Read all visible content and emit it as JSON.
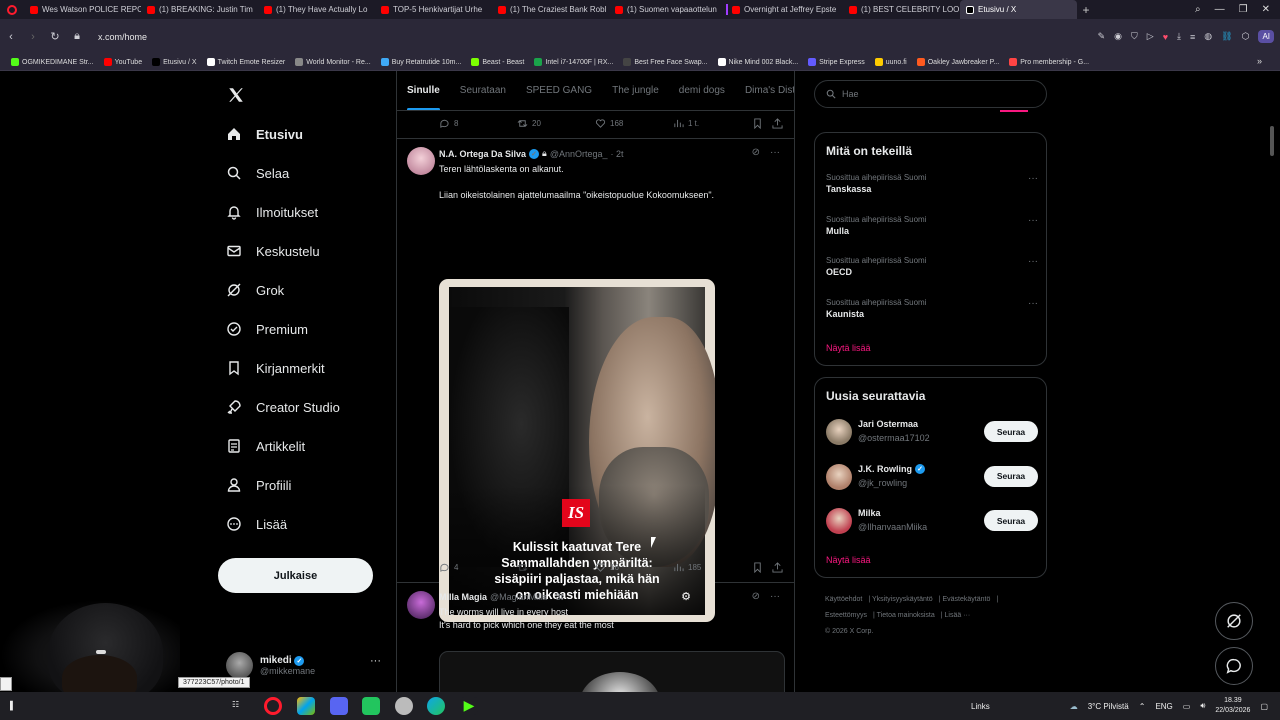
{
  "browser": {
    "tabs": [
      {
        "label": "Wes Watson POLICE REPO",
        "color": "#ff0000",
        "active": false
      },
      {
        "label": "(1) BREAKING: Justin Tim",
        "color": "#ff0000",
        "active": false
      },
      {
        "label": "(1) They Have Actually Lo",
        "color": "#ff0000",
        "active": false
      },
      {
        "label": "TOP-5 Henkivartijat Urhe",
        "color": "#ff0000",
        "active": false
      },
      {
        "label": "(1) The Craziest Bank Robl",
        "color": "#ff0000",
        "active": false
      },
      {
        "label": "(1) Suomen vapaaottelun",
        "color": "#ff0000",
        "active": false
      },
      {
        "label": "Overnight at Jeffrey Epste",
        "color": "#ff0000",
        "active": false
      },
      {
        "label": "(1) BEST CELEBRITY LOOK",
        "color": "#ff0000",
        "active": false
      },
      {
        "label": "Etusivu / X",
        "color": "#000000",
        "active": true
      }
    ],
    "url": "x.com/home",
    "ai_label": "AI",
    "bookmarks": [
      {
        "label": "OGMIKEDIMANE Str...",
        "color": "#53fc18"
      },
      {
        "label": "YouTube",
        "color": "#ff0000"
      },
      {
        "label": "Etusivu / X",
        "color": "#000000"
      },
      {
        "label": "Twitch Emote Resizer",
        "color": "#ffffff"
      },
      {
        "label": "World Monitor - Re...",
        "color": "#888888"
      },
      {
        "label": "Buy Retatrutide 10m...",
        "color": "#3fa9f5"
      },
      {
        "label": "Beast - Beast",
        "color": "#7cff00"
      },
      {
        "label": "Intel i7-14700F | RX...",
        "color": "#1aa34a"
      },
      {
        "label": "Best Free Face Swap...",
        "color": "#444444"
      },
      {
        "label": "Nike Mind 002 Black...",
        "color": "#ffffff"
      },
      {
        "label": "Stripe Express",
        "color": "#635bff"
      },
      {
        "label": "uuno.fi",
        "color": "#ffcc00"
      },
      {
        "label": "Oakley Jawbreaker P...",
        "color": "#ff5a1f"
      },
      {
        "label": "Pro membership - G...",
        "color": "#ff4444"
      }
    ]
  },
  "sidebar": {
    "items": [
      {
        "label": "Etusivu",
        "icon": "home-icon"
      },
      {
        "label": "Selaa",
        "icon": "search-icon"
      },
      {
        "label": "Ilmoitukset",
        "icon": "bell-icon"
      },
      {
        "label": "Keskustelu",
        "icon": "mail-icon"
      },
      {
        "label": "Grok",
        "icon": "grok-icon"
      },
      {
        "label": "Premium",
        "icon": "premium-icon"
      },
      {
        "label": "Kirjanmerkit",
        "icon": "bookmark-icon"
      },
      {
        "label": "Creator Studio",
        "icon": "rocket-icon"
      },
      {
        "label": "Artikkelit",
        "icon": "article-icon"
      },
      {
        "label": "Profiili",
        "icon": "profile-icon"
      },
      {
        "label": "Lisää",
        "icon": "more-circle-icon"
      }
    ],
    "post_button": "Julkaise",
    "account": {
      "name": "mikedi",
      "handle": "@mikkemane"
    }
  },
  "feed": {
    "tabs": [
      "Sinulle",
      "Seurataan",
      "SPEED GANG",
      "The jungle",
      "demi dogs",
      "Dima's Dist"
    ],
    "prev_actions": {
      "replies": "8",
      "reposts": "20",
      "likes": "168",
      "views": "1 t."
    },
    "tweet1": {
      "name": "N.A. Ortega Da Silva",
      "handle": "@AnnOrtega_",
      "time": "· 2t",
      "line1": "Teren lähtölaskenta on alkanut.",
      "line2": "Liian oikeistolainen ajattelumaailma \"oikeistopuolue Kokoomukseen\".",
      "media_logo": "IS",
      "media_caption": "Kulissit kaatuvat Tere\nSammallahden ympäriltä:\nsisäpiiri paljastaa, mikä hän\non oikeasti miehiään",
      "actions": {
        "replies": "4",
        "reposts": "",
        "likes": "16",
        "views": "185"
      }
    },
    "tweet2": {
      "name": "Milla Magia",
      "handle": "@MagianMilla",
      "time": "· 3t",
      "line1": "The worms will live in every host",
      "line2": "It's hard to pick which one they eat the most"
    }
  },
  "right": {
    "search_placeholder": "Hae",
    "trends_title": "Mitä on tekeillä",
    "trends": [
      {
        "context": "Suosittua aihepiirissä Suomi",
        "topic": "Tanskassa"
      },
      {
        "context": "Suosittua aihepiirissä Suomi",
        "topic": "Mulla"
      },
      {
        "context": "Suosittua aihepiirissä Suomi",
        "topic": "OECD"
      },
      {
        "context": "Suosittua aihepiirissä Suomi",
        "topic": "Kaunista"
      }
    ],
    "show_more": "Näytä lisää",
    "who_title": "Uusia seurattavia",
    "who": [
      {
        "name": "Jari Ostermaa",
        "handle": "@ostermaa17102",
        "verified": false,
        "avatar": "#8a7a66"
      },
      {
        "name": "J.K. Rowling",
        "handle": "@jk_rowling",
        "verified": true,
        "avatar": "#b0806a"
      },
      {
        "name": "Milka",
        "handle": "@IlhanvaanMiika",
        "verified": false,
        "avatar": "#c04050"
      }
    ],
    "follow_label": "Seuraa",
    "who_show_more": "Näytä lisää",
    "footer": [
      "Käyttöehdot",
      "Yksityisyyskäytäntö",
      "Evästekäytäntö",
      "Esteettömyys",
      "Tietoa mainoksista",
      "Lisää ···",
      "© 2026 X Corp."
    ]
  },
  "overlay": {
    "tooltip": "377223C57/photo/1"
  },
  "taskbar": {
    "links_label": "Links",
    "weather": "3°C Pilvistä",
    "lang": "ENG",
    "time": "18.39",
    "date": "22/03/2026"
  }
}
